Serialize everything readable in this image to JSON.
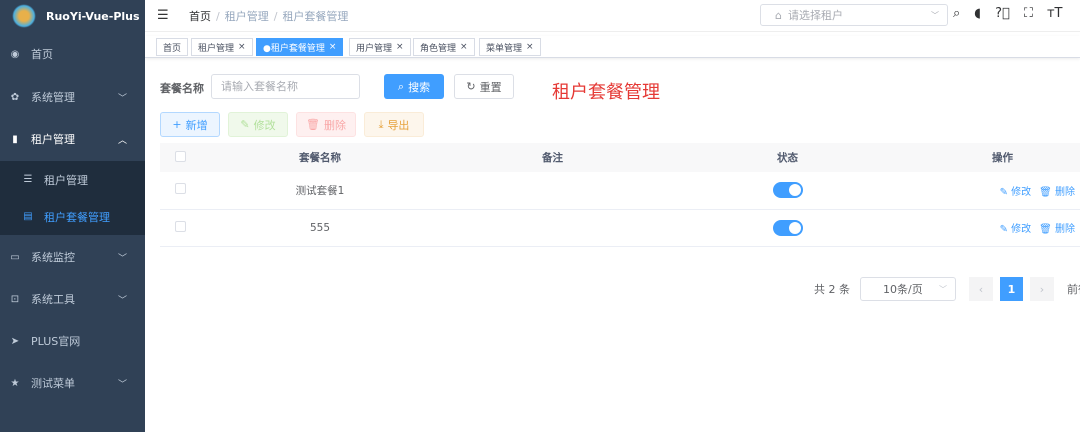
{
  "app": {
    "name": "RuoYi-Vue-Plus"
  },
  "sidebar": {
    "items": [
      {
        "label": "首页",
        "icon": "dashboard-icon"
      },
      {
        "label": "系统管理",
        "icon": "gear-icon"
      },
      {
        "label": "租户管理",
        "icon": "chart-icon"
      },
      {
        "label": "租户管理",
        "icon": "list-icon"
      },
      {
        "label": "租户套餐管理",
        "icon": "form-icon"
      },
      {
        "label": "系统监控",
        "icon": "monitor-icon"
      },
      {
        "label": "系统工具",
        "icon": "tool-icon"
      },
      {
        "label": "PLUS官网",
        "icon": "send-icon"
      },
      {
        "label": "测试菜单",
        "icon": "star-icon"
      }
    ]
  },
  "breadcrumb": [
    "首页",
    "租户管理",
    "租户套餐管理"
  ],
  "header": {
    "tenant_placeholder": "请选择租户"
  },
  "tags": [
    {
      "label": "首页"
    },
    {
      "label": "租户管理"
    },
    {
      "label": "●租户套餐管理"
    },
    {
      "label": "用户管理"
    },
    {
      "label": "角色管理"
    },
    {
      "label": "菜单管理"
    }
  ],
  "search": {
    "label": "套餐名称",
    "placeholder": "请输入套餐名称",
    "search_btn": "搜索",
    "reset_btn": "重置"
  },
  "page_title": "租户套餐管理",
  "toolbar": {
    "add": "新增",
    "edit": "修改",
    "delete": "删除",
    "export": "导出"
  },
  "table": {
    "headers": [
      "套餐名称",
      "备注",
      "状态",
      "操作"
    ],
    "rows": [
      {
        "name": "测试套餐1",
        "remark": "",
        "status": true
      },
      {
        "name": "555",
        "remark": "",
        "status": true
      }
    ],
    "edit": "修改",
    "delete": "删除"
  },
  "pagination": {
    "total": "共 2 条",
    "page_size": "10条/页",
    "current": "1",
    "goto": "前往"
  },
  "colors": {
    "primary": "#409eff",
    "sidebar": "#304156",
    "title": "#e53935"
  }
}
